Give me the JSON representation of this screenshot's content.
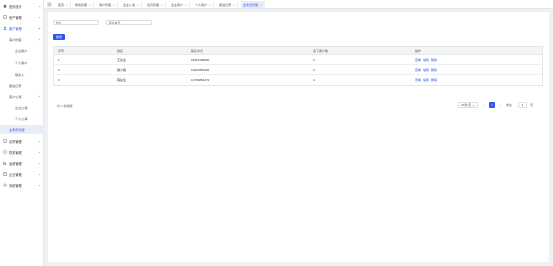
{
  "sidebar": {
    "items": [
      {
        "label": "首页统计",
        "icon": "home-icon"
      },
      {
        "label": "资产管理",
        "icon": "wallet-icon"
      },
      {
        "label": "客户管理",
        "icon": "users-icon"
      }
    ],
    "sub_customer": [
      {
        "label": "客户管理"
      },
      {
        "label": "企业客户"
      },
      {
        "label": "个人客户"
      },
      {
        "label": "联系人"
      },
      {
        "label": "跟进记录"
      },
      {
        "label": "客户公海"
      },
      {
        "label": "企业公海"
      },
      {
        "label": "个人公海"
      },
      {
        "label": "业务员管理"
      }
    ],
    "bottom_items": [
      {
        "label": "合同管理",
        "icon": "document-icon"
      },
      {
        "label": "财务管理",
        "icon": "finance-icon"
      },
      {
        "label": "运营管理",
        "icon": "chart-icon"
      },
      {
        "label": "企业管理",
        "icon": "building-icon"
      },
      {
        "label": "系统管理",
        "icon": "gear-icon"
      }
    ]
  },
  "tabs": [
    {
      "label": "首页"
    },
    {
      "label": "角色管理"
    },
    {
      "label": "用户管理"
    },
    {
      "label": "企业公海"
    },
    {
      "label": "合同管理"
    },
    {
      "label": "企业客户"
    },
    {
      "label": "个人客户"
    },
    {
      "label": "跟进记录"
    },
    {
      "label": "业务员管理"
    }
  ],
  "search": {
    "name_placeholder": "姓名",
    "phone_placeholder": "联系电话"
  },
  "add_button": "新增",
  "table": {
    "headers": [
      "序号",
      "姓名",
      "联系方式",
      "名下客户数",
      "操作"
    ],
    "rows": [
      {
        "index": "1",
        "name": "王先生",
        "phone": "18497298660",
        "count": "3"
      },
      {
        "index": "2",
        "name": "魏小姐",
        "phone": "13607854930",
        "count": "0"
      },
      {
        "index": "3",
        "name": "韩先生",
        "phone": "13709864473",
        "count": "4"
      }
    ],
    "actions": [
      "查看",
      "编辑",
      "删除"
    ]
  },
  "pagination": {
    "total_text": "共 3 条数据",
    "page_size": "20条/页",
    "current_page": "1",
    "goto_label": "前往",
    "goto_value": "1",
    "goto_suffix": "页"
  },
  "colors": {
    "accent": "#2f54eb",
    "background": "#eef0f4"
  }
}
